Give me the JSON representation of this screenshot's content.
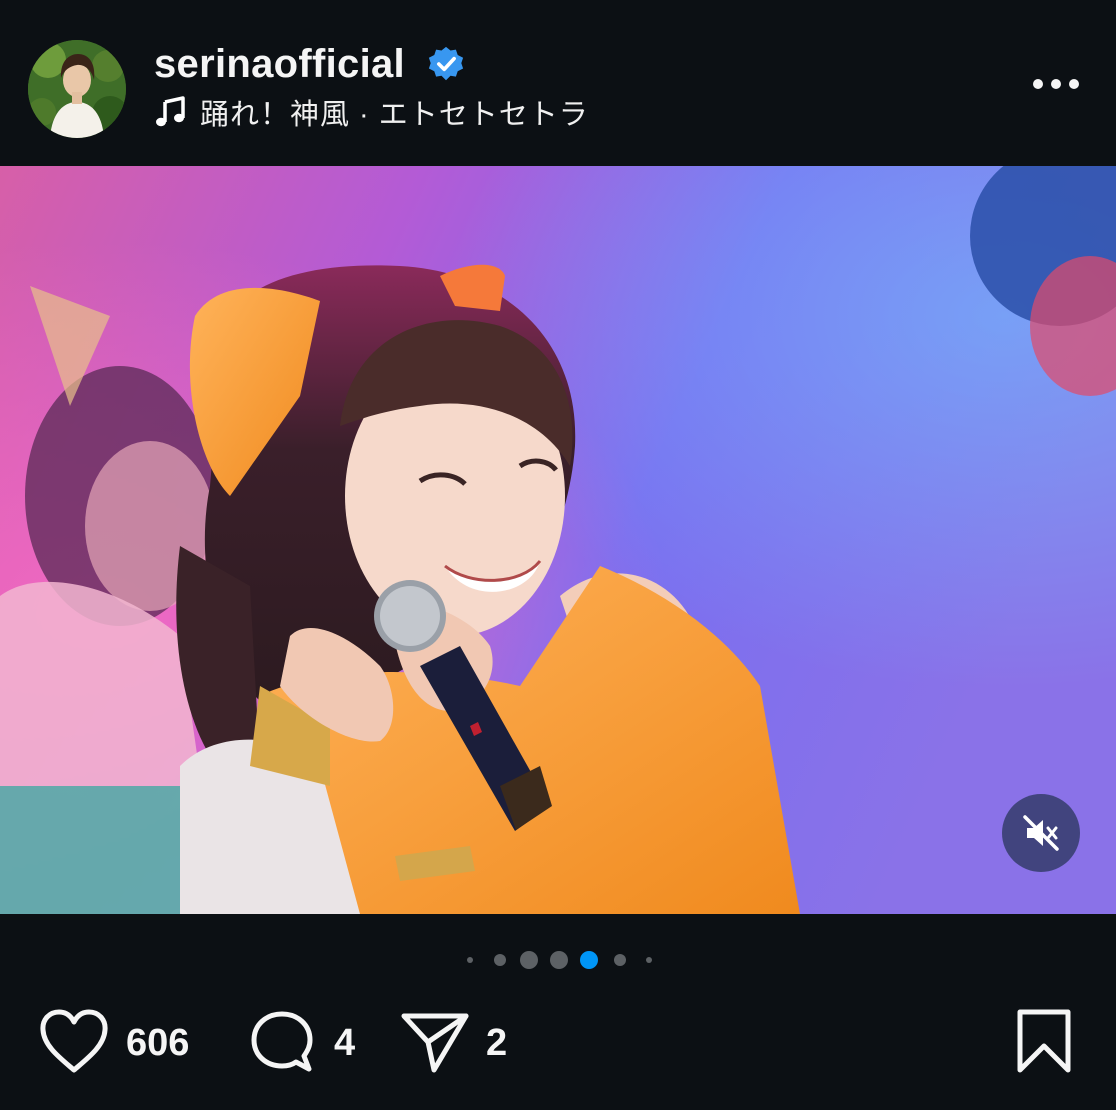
{
  "header": {
    "username": "serinaofficial",
    "verified": true,
    "audio": "踊れ！神風 · エトセトセトラ"
  },
  "icons": {
    "avatar": "profile-avatar",
    "verified": "verified-badge-icon",
    "music": "music-note-icon",
    "more": "more-options-icon",
    "mute": "muted-speaker-icon",
    "like": "heart-icon",
    "comment": "comment-bubble-icon",
    "share": "paper-plane-icon",
    "save": "bookmark-icon"
  },
  "carousel": {
    "total_dots": 7,
    "active_index": 4
  },
  "actions": {
    "likes": "606",
    "comments": "4",
    "shares": "2"
  },
  "colors": {
    "background": "#0c1014",
    "verified": "#3897f0",
    "active_dot": "#0095f6",
    "inactive_dot": "#5d6165"
  }
}
